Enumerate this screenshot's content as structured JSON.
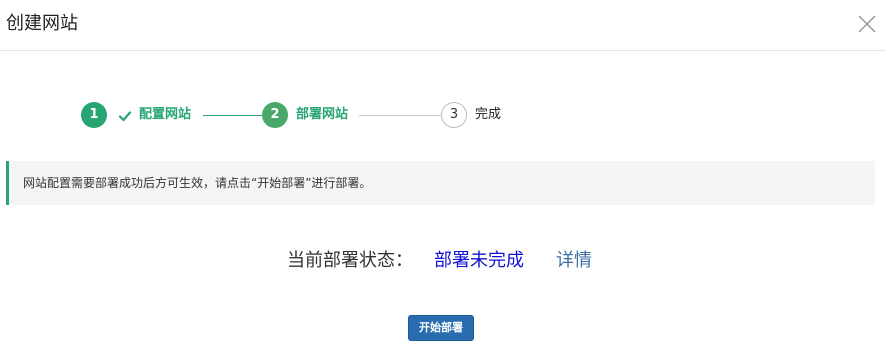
{
  "dialog": {
    "title": "创建网站"
  },
  "steps": [
    {
      "number": "1",
      "label": "配置网站",
      "state": "done"
    },
    {
      "number": "2",
      "label": "部署网站",
      "state": "active"
    },
    {
      "number": "3",
      "label": "完成",
      "state": "todo"
    }
  ],
  "notice": {
    "text": "网站配置需要部署成功后方可生效，请点击“开始部署”进行部署。"
  },
  "status": {
    "label": "当前部署状态：",
    "value": "部署未完成",
    "detail_link": "详情"
  },
  "actions": {
    "deploy_label": "开始部署"
  },
  "colors": {
    "accent_green": "#27a572",
    "status_blue": "#1212d6",
    "button_blue": "#2a6cb0"
  }
}
